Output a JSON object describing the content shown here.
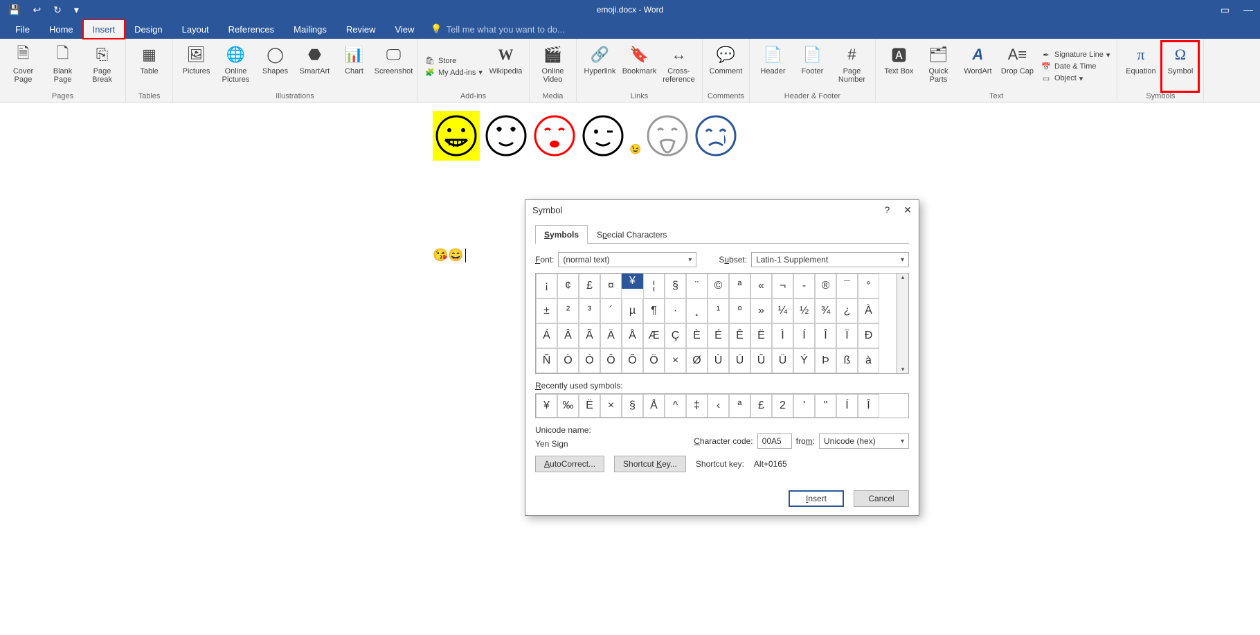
{
  "title": "emoji.docx - Word",
  "tabs": [
    "File",
    "Home",
    "Insert",
    "Design",
    "Layout",
    "References",
    "Mailings",
    "Review",
    "View"
  ],
  "active_tab": "Insert",
  "tellme": "Tell me what you want to do...",
  "ribbon": {
    "pages": {
      "label": "Pages",
      "items": [
        "Cover Page",
        "Blank Page",
        "Page Break"
      ]
    },
    "tables": {
      "label": "Tables",
      "items": [
        "Table"
      ]
    },
    "illustrations": {
      "label": "Illustrations",
      "items": [
        "Pictures",
        "Online Pictures",
        "Shapes",
        "SmartArt",
        "Chart",
        "Screenshot"
      ]
    },
    "addins": {
      "label": "Add-ins",
      "store": "Store",
      "myaddins": "My Add-ins",
      "wikipedia": "Wikipedia"
    },
    "media": {
      "label": "Media",
      "items": [
        "Online Video"
      ]
    },
    "links": {
      "label": "Links",
      "items": [
        "Hyperlink",
        "Bookmark",
        "Cross-reference"
      ]
    },
    "comments": {
      "label": "Comments",
      "items": [
        "Comment"
      ]
    },
    "headerfooter": {
      "label": "Header & Footer",
      "items": [
        "Header",
        "Footer",
        "Page Number"
      ]
    },
    "text": {
      "label": "Text",
      "items": [
        "Text Box",
        "Quick Parts",
        "WordArt",
        "Drop Cap"
      ],
      "side": [
        "Signature Line",
        "Date & Time",
        "Object"
      ]
    },
    "symbols": {
      "label": "Symbols",
      "items": [
        "Equation",
        "Symbol"
      ]
    }
  },
  "dialog": {
    "title": "Symbol",
    "tabs": [
      "Symbols",
      "Special Characters"
    ],
    "font_label": "Font:",
    "font_value": "(normal text)",
    "subset_label": "Subset:",
    "subset_value": "Latin-1 Supplement",
    "grid_rows": [
      [
        "¡",
        "¢",
        "£",
        "¤",
        "¥",
        "¦",
        "§",
        "¨",
        "©",
        "ª",
        "«",
        "¬",
        "-",
        "®",
        "¯",
        "°"
      ],
      [
        "±",
        "²",
        "³",
        "´",
        "µ",
        "¶",
        "·",
        "¸",
        "¹",
        "º",
        "»",
        "¼",
        "½",
        "¾",
        "¿",
        "À"
      ],
      [
        "Á",
        "Â",
        "Ã",
        "Ä",
        "Å",
        "Æ",
        "Ç",
        "È",
        "É",
        "Ê",
        "Ë",
        "Ì",
        "Í",
        "Î",
        "Ï",
        "Ð"
      ],
      [
        "Ñ",
        "Ò",
        "Ó",
        "Ô",
        "Õ",
        "Ö",
        "×",
        "Ø",
        "Ù",
        "Ú",
        "Û",
        "Ü",
        "Ý",
        "Þ",
        "ß",
        "à"
      ]
    ],
    "selected_symbol": "¥",
    "recent_label": "Recently used symbols:",
    "recent": [
      "¥",
      "‰",
      "Ë",
      "×",
      "§",
      "Å",
      "^",
      "‡",
      "‹",
      "ª",
      "£",
      "2",
      "'",
      "\"",
      "Í",
      "Î"
    ],
    "unicode_name_label": "Unicode name:",
    "unicode_name": "Yen Sign",
    "charcode_label": "Character code:",
    "charcode": "00A5",
    "from_label": "from:",
    "from_value": "Unicode (hex)",
    "autocorrect": "AutoCorrect...",
    "shortcutkey_btn": "Shortcut Key...",
    "shortcut_label": "Shortcut key:",
    "shortcut_value": "Alt+0165",
    "insert": "Insert",
    "cancel": "Cancel"
  },
  "doc": {
    "line2": "😘😄"
  }
}
